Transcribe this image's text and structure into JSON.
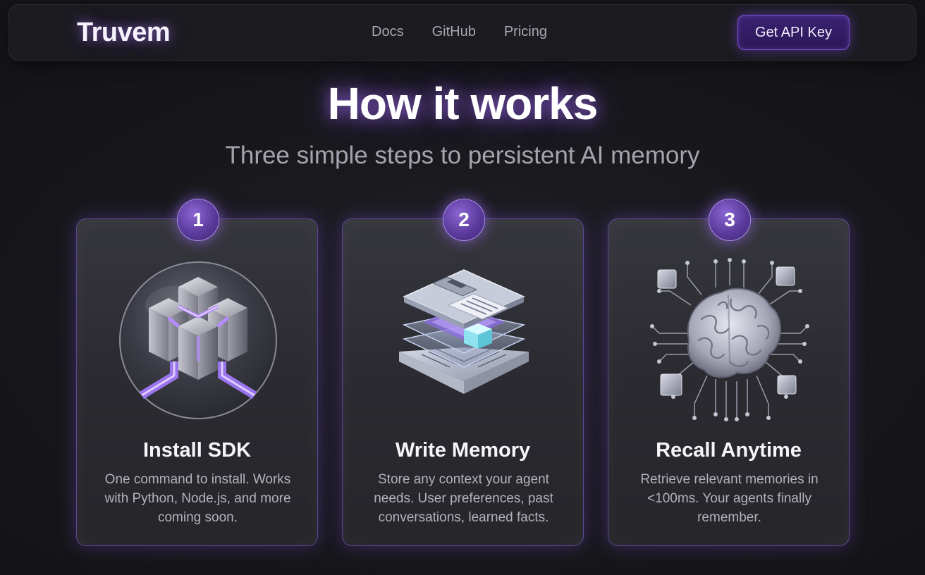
{
  "nav": {
    "logo": "Truvem",
    "links": [
      "Docs",
      "GitHub",
      "Pricing"
    ],
    "cta_label": "Get API Key"
  },
  "hero": {
    "title": "How it works",
    "subtitle": "Three simple steps to persistent AI memory"
  },
  "steps": [
    {
      "number": "1",
      "title": "Install SDK",
      "description": "One command to install. Works with Python, Node.js, and more coming soon.",
      "icon": "cube-sdk-icon"
    },
    {
      "number": "2",
      "title": "Write Memory",
      "description": "Store any context your agent needs. User preferences, past conversations, learned facts.",
      "icon": "floppy-disk-stack-icon"
    },
    {
      "number": "3",
      "title": "Recall Anytime",
      "description": "Retrieve relevant memories in <100ms. Your agents finally remember.",
      "icon": "brain-circuit-icon"
    }
  ],
  "colors": {
    "background": "#17171b",
    "accent": "#7b4fd6",
    "accent_glow": "#a070ff",
    "card_border": "#5c4894"
  }
}
